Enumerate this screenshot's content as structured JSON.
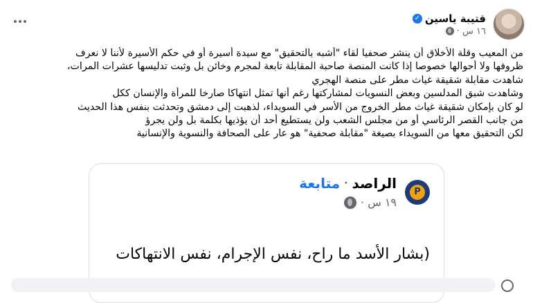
{
  "post": {
    "author": "قتيبة ياسين",
    "time": "١٦ س ·",
    "lines": [
      "من المعيب وقلة الأخلاق أن ينشر صحفيا لقاء \"أشبه بالتحقيق\" مع سيدة أسيرة أو في حكم الأسيرة لأننا لا نعرف",
      "ظروفها ولا أحوالها خصوصا إذا كانت المنصة صاحبة المقابلة تابعة لمجرم وخائن بل وثبت تدليسها عشرات المرات،",
      "شاهدت مقابلة شقيقة غياث مطر على منصة الهجري",
      "وشاهدت شبق المدلسين وبعض النسويات لمشاركتها رغم أنها تمثل انتهاكا صارخا للمرأة والإنسان ككل",
      "لو كان بإمكان شقيقة غياث مطر الخروج من الأسر في السويداء، لذهبت إلى دمشق وتحدثت بنفس هذا الحديث",
      "من جانب القصر الرئاسي أو من مجلس الشعب ولن يستطيع أحد أن يؤذيها بكلمة بل ولن يجرؤ",
      "لكن التحقيق معها من السويداء بصيغة \"مقابلة صحفية\" هو عار على الصحافة والنسوية والإنسانية"
    ]
  },
  "shared": {
    "page_name": "الراصد",
    "dot": "·",
    "follow_label": "متابعة",
    "time": "١٩ س ·",
    "text": "(بشار الأسد ما راح، نفس الإجرام، نفس الانتهاكات",
    "logo_glyph": "P"
  },
  "icons": {
    "verified": "verified-badge-icon",
    "globe": "globe-icon",
    "more": "more-options-icon"
  },
  "colors": {
    "accent": "#1877f2",
    "secondary_text": "#65676b",
    "logo_bg": "#1c3b7a",
    "logo_fg": "#f2a20a"
  }
}
